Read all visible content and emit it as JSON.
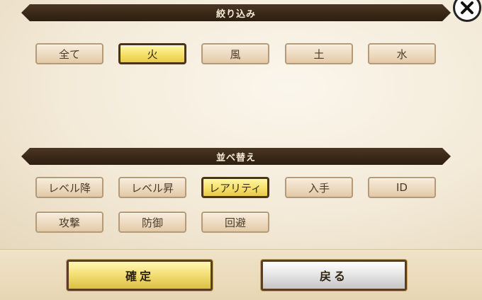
{
  "filter": {
    "title": "絞り込み",
    "options": [
      "全て",
      "火",
      "風",
      "土",
      "水"
    ],
    "selected": "火"
  },
  "sort": {
    "title": "並べ替え",
    "options": [
      "レベル降",
      "レベル昇",
      "レアリティ",
      "入手",
      "ID",
      "攻撃",
      "防御",
      "回避"
    ],
    "selected": "レアリティ"
  },
  "actions": {
    "confirm_label": "確定",
    "back_label": "戻る"
  },
  "icons": {
    "close": "close-icon"
  },
  "colors": {
    "banner": "#3a2817",
    "active_fill": "#f5e06a",
    "button_fill": "#ecd8bd"
  }
}
